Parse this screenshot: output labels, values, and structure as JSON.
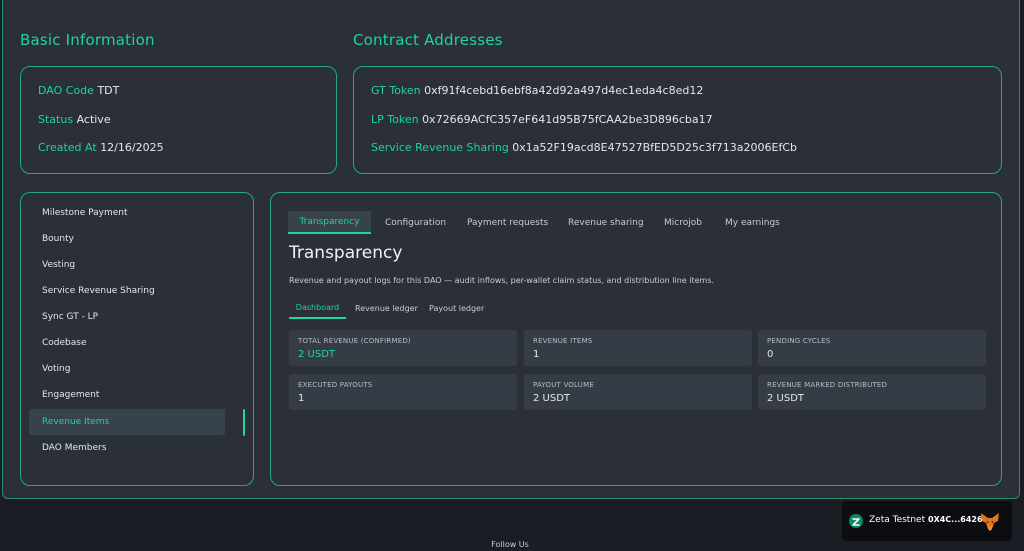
{
  "basic_info": {
    "title": "Basic Information",
    "rows": [
      {
        "key": "DAO Code",
        "value": "TDT"
      },
      {
        "key": "Status",
        "value": "Active"
      },
      {
        "key": "Created At",
        "value": "12/16/2025"
      }
    ]
  },
  "contracts": {
    "title": "Contract Addresses",
    "rows": [
      {
        "key": "GT Token",
        "value": "0xf91f4cebd16ebf8a42d92a497d4ec1eda4c8ed12"
      },
      {
        "key": "LP Token",
        "value": "0x72669ACfC357eF641d95B75fCAA2be3D896cba17"
      },
      {
        "key": "Service Revenue Sharing",
        "value": "0x1a52F19acd8E47527BfED5D25c3f713a2006EfCb"
      }
    ]
  },
  "sidebar": {
    "items": [
      {
        "label": "Milestone Payment"
      },
      {
        "label": "Bounty"
      },
      {
        "label": "Vesting"
      },
      {
        "label": "Service Revenue Sharing"
      },
      {
        "label": "Sync GT - LP"
      },
      {
        "label": "Codebase"
      },
      {
        "label": "Voting"
      },
      {
        "label": "Engagement"
      },
      {
        "label": "Revenue Items"
      },
      {
        "label": "DAO Members"
      }
    ],
    "active": "Revenue Items"
  },
  "tabs": {
    "items": [
      {
        "label": "Transparency"
      },
      {
        "label": "Configuration"
      },
      {
        "label": "Payment requests"
      },
      {
        "label": "Revenue sharing"
      },
      {
        "label": "Microjob"
      },
      {
        "label": "My earnings"
      }
    ],
    "active": "Transparency"
  },
  "transparency": {
    "heading": "Transparency",
    "description": "Revenue and payout logs for this DAO — audit inflows, per-wallet claim status, and distribution line items.",
    "subtabs": [
      {
        "label": "Dashboard"
      },
      {
        "label": "Revenue ledger"
      },
      {
        "label": "Payout ledger"
      }
    ],
    "active_subtab": "Dashboard",
    "stats": [
      {
        "label": "TOTAL REVENUE (CONFIRMED)",
        "value": "2 USDT",
        "accent": true
      },
      {
        "label": "REVENUE ITEMS",
        "value": "1"
      },
      {
        "label": "PENDING CYCLES",
        "value": "0"
      },
      {
        "label": "EXECUTED PAYOUTS",
        "value": "1"
      },
      {
        "label": "PAYOUT VOLUME",
        "value": "2 USDT"
      },
      {
        "label": "REVENUE MARKED DISTRIBUTED",
        "value": "2 USDT"
      }
    ]
  },
  "wallet": {
    "network": "Zeta Testnet",
    "address": "0X4C...6426"
  },
  "footer": {
    "follow_us": "Follow Us"
  },
  "colors": {
    "accent": "#1fd3a3",
    "border": "#23a882",
    "panel": "#2a2f38",
    "page": "#1a1d23"
  }
}
